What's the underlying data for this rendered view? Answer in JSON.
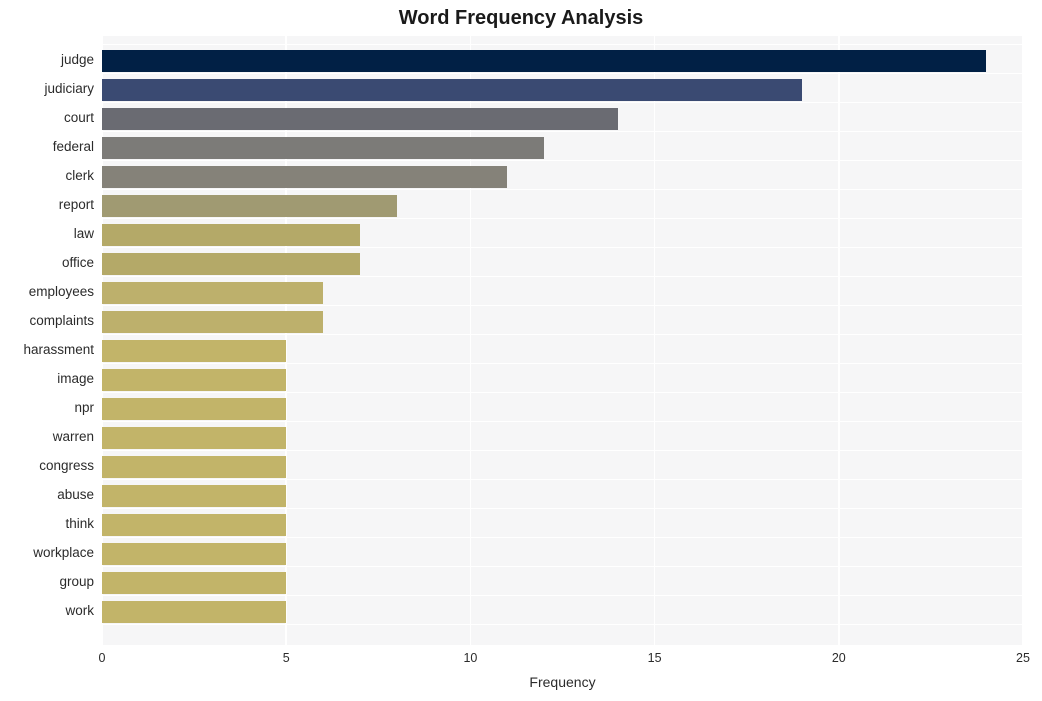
{
  "chart_data": {
    "type": "bar",
    "orientation": "horizontal",
    "title": "Word Frequency Analysis",
    "xlabel": "Frequency",
    "ylabel": "",
    "xlim": [
      0,
      25
    ],
    "ylim": null,
    "xticks": [
      "0",
      "5",
      "10",
      "15",
      "20",
      "25"
    ],
    "xtick_values": [
      0,
      5,
      10,
      15,
      20,
      25
    ],
    "grid": true,
    "legend": null,
    "categories": [
      "judge",
      "judiciary",
      "court",
      "federal",
      "clerk",
      "report",
      "law",
      "office",
      "employees",
      "complaints",
      "harassment",
      "image",
      "npr",
      "warren",
      "congress",
      "abuse",
      "think",
      "workplace",
      "group",
      "work"
    ],
    "values": [
      24,
      19,
      14,
      12,
      11,
      8,
      7,
      7,
      6,
      6,
      5,
      5,
      5,
      5,
      5,
      5,
      5,
      5,
      5,
      5
    ],
    "bar_colors": [
      "#012045",
      "#3a4a72",
      "#6a6b72",
      "#7c7b78",
      "#858279",
      "#a09a72",
      "#b4a968",
      "#b4a968",
      "#bdb06c",
      "#bdb06c",
      "#c2b469",
      "#c2b469",
      "#c2b469",
      "#c2b469",
      "#c2b469",
      "#c2b469",
      "#c2b469",
      "#c2b469",
      "#c2b469",
      "#c2b469"
    ],
    "plot_background": "#f6f6f7",
    "grid_color": "#ffffff",
    "figure_background": "#ffffff"
  }
}
